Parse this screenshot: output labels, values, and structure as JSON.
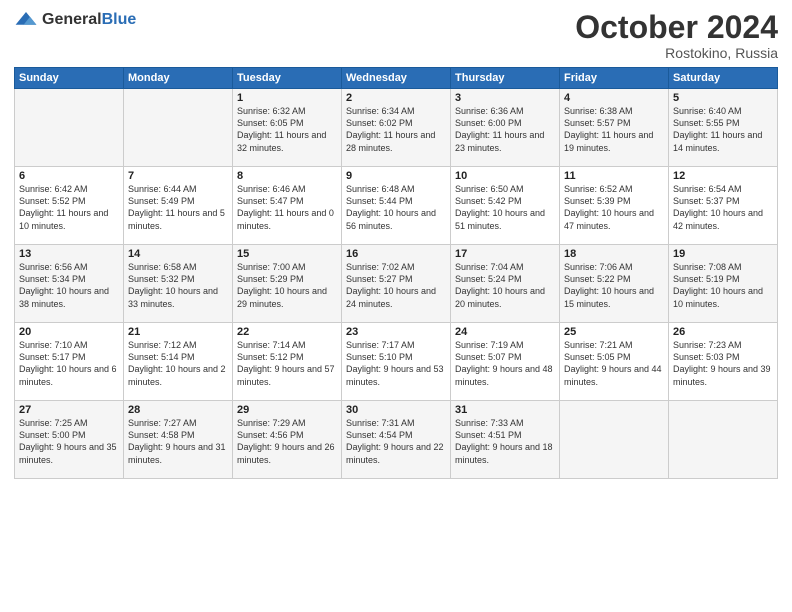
{
  "header": {
    "logo": {
      "general": "General",
      "blue": "Blue"
    },
    "title": "October 2024",
    "subtitle": "Rostokino, Russia"
  },
  "days_of_week": [
    "Sunday",
    "Monday",
    "Tuesday",
    "Wednesday",
    "Thursday",
    "Friday",
    "Saturday"
  ],
  "weeks": [
    [
      {
        "day": "",
        "sunrise": "",
        "sunset": "",
        "daylight": ""
      },
      {
        "day": "",
        "sunrise": "",
        "sunset": "",
        "daylight": ""
      },
      {
        "day": "1",
        "sunrise": "Sunrise: 6:32 AM",
        "sunset": "Sunset: 6:05 PM",
        "daylight": "Daylight: 11 hours and 32 minutes."
      },
      {
        "day": "2",
        "sunrise": "Sunrise: 6:34 AM",
        "sunset": "Sunset: 6:02 PM",
        "daylight": "Daylight: 11 hours and 28 minutes."
      },
      {
        "day": "3",
        "sunrise": "Sunrise: 6:36 AM",
        "sunset": "Sunset: 6:00 PM",
        "daylight": "Daylight: 11 hours and 23 minutes."
      },
      {
        "day": "4",
        "sunrise": "Sunrise: 6:38 AM",
        "sunset": "Sunset: 5:57 PM",
        "daylight": "Daylight: 11 hours and 19 minutes."
      },
      {
        "day": "5",
        "sunrise": "Sunrise: 6:40 AM",
        "sunset": "Sunset: 5:55 PM",
        "daylight": "Daylight: 11 hours and 14 minutes."
      }
    ],
    [
      {
        "day": "6",
        "sunrise": "Sunrise: 6:42 AM",
        "sunset": "Sunset: 5:52 PM",
        "daylight": "Daylight: 11 hours and 10 minutes."
      },
      {
        "day": "7",
        "sunrise": "Sunrise: 6:44 AM",
        "sunset": "Sunset: 5:49 PM",
        "daylight": "Daylight: 11 hours and 5 minutes."
      },
      {
        "day": "8",
        "sunrise": "Sunrise: 6:46 AM",
        "sunset": "Sunset: 5:47 PM",
        "daylight": "Daylight: 11 hours and 0 minutes."
      },
      {
        "day": "9",
        "sunrise": "Sunrise: 6:48 AM",
        "sunset": "Sunset: 5:44 PM",
        "daylight": "Daylight: 10 hours and 56 minutes."
      },
      {
        "day": "10",
        "sunrise": "Sunrise: 6:50 AM",
        "sunset": "Sunset: 5:42 PM",
        "daylight": "Daylight: 10 hours and 51 minutes."
      },
      {
        "day": "11",
        "sunrise": "Sunrise: 6:52 AM",
        "sunset": "Sunset: 5:39 PM",
        "daylight": "Daylight: 10 hours and 47 minutes."
      },
      {
        "day": "12",
        "sunrise": "Sunrise: 6:54 AM",
        "sunset": "Sunset: 5:37 PM",
        "daylight": "Daylight: 10 hours and 42 minutes."
      }
    ],
    [
      {
        "day": "13",
        "sunrise": "Sunrise: 6:56 AM",
        "sunset": "Sunset: 5:34 PM",
        "daylight": "Daylight: 10 hours and 38 minutes."
      },
      {
        "day": "14",
        "sunrise": "Sunrise: 6:58 AM",
        "sunset": "Sunset: 5:32 PM",
        "daylight": "Daylight: 10 hours and 33 minutes."
      },
      {
        "day": "15",
        "sunrise": "Sunrise: 7:00 AM",
        "sunset": "Sunset: 5:29 PM",
        "daylight": "Daylight: 10 hours and 29 minutes."
      },
      {
        "day": "16",
        "sunrise": "Sunrise: 7:02 AM",
        "sunset": "Sunset: 5:27 PM",
        "daylight": "Daylight: 10 hours and 24 minutes."
      },
      {
        "day": "17",
        "sunrise": "Sunrise: 7:04 AM",
        "sunset": "Sunset: 5:24 PM",
        "daylight": "Daylight: 10 hours and 20 minutes."
      },
      {
        "day": "18",
        "sunrise": "Sunrise: 7:06 AM",
        "sunset": "Sunset: 5:22 PM",
        "daylight": "Daylight: 10 hours and 15 minutes."
      },
      {
        "day": "19",
        "sunrise": "Sunrise: 7:08 AM",
        "sunset": "Sunset: 5:19 PM",
        "daylight": "Daylight: 10 hours and 10 minutes."
      }
    ],
    [
      {
        "day": "20",
        "sunrise": "Sunrise: 7:10 AM",
        "sunset": "Sunset: 5:17 PM",
        "daylight": "Daylight: 10 hours and 6 minutes."
      },
      {
        "day": "21",
        "sunrise": "Sunrise: 7:12 AM",
        "sunset": "Sunset: 5:14 PM",
        "daylight": "Daylight: 10 hours and 2 minutes."
      },
      {
        "day": "22",
        "sunrise": "Sunrise: 7:14 AM",
        "sunset": "Sunset: 5:12 PM",
        "daylight": "Daylight: 9 hours and 57 minutes."
      },
      {
        "day": "23",
        "sunrise": "Sunrise: 7:17 AM",
        "sunset": "Sunset: 5:10 PM",
        "daylight": "Daylight: 9 hours and 53 minutes."
      },
      {
        "day": "24",
        "sunrise": "Sunrise: 7:19 AM",
        "sunset": "Sunset: 5:07 PM",
        "daylight": "Daylight: 9 hours and 48 minutes."
      },
      {
        "day": "25",
        "sunrise": "Sunrise: 7:21 AM",
        "sunset": "Sunset: 5:05 PM",
        "daylight": "Daylight: 9 hours and 44 minutes."
      },
      {
        "day": "26",
        "sunrise": "Sunrise: 7:23 AM",
        "sunset": "Sunset: 5:03 PM",
        "daylight": "Daylight: 9 hours and 39 minutes."
      }
    ],
    [
      {
        "day": "27",
        "sunrise": "Sunrise: 7:25 AM",
        "sunset": "Sunset: 5:00 PM",
        "daylight": "Daylight: 9 hours and 35 minutes."
      },
      {
        "day": "28",
        "sunrise": "Sunrise: 7:27 AM",
        "sunset": "Sunset: 4:58 PM",
        "daylight": "Daylight: 9 hours and 31 minutes."
      },
      {
        "day": "29",
        "sunrise": "Sunrise: 7:29 AM",
        "sunset": "Sunset: 4:56 PM",
        "daylight": "Daylight: 9 hours and 26 minutes."
      },
      {
        "day": "30",
        "sunrise": "Sunrise: 7:31 AM",
        "sunset": "Sunset: 4:54 PM",
        "daylight": "Daylight: 9 hours and 22 minutes."
      },
      {
        "day": "31",
        "sunrise": "Sunrise: 7:33 AM",
        "sunset": "Sunset: 4:51 PM",
        "daylight": "Daylight: 9 hours and 18 minutes."
      },
      {
        "day": "",
        "sunrise": "",
        "sunset": "",
        "daylight": ""
      },
      {
        "day": "",
        "sunrise": "",
        "sunset": "",
        "daylight": ""
      }
    ]
  ]
}
